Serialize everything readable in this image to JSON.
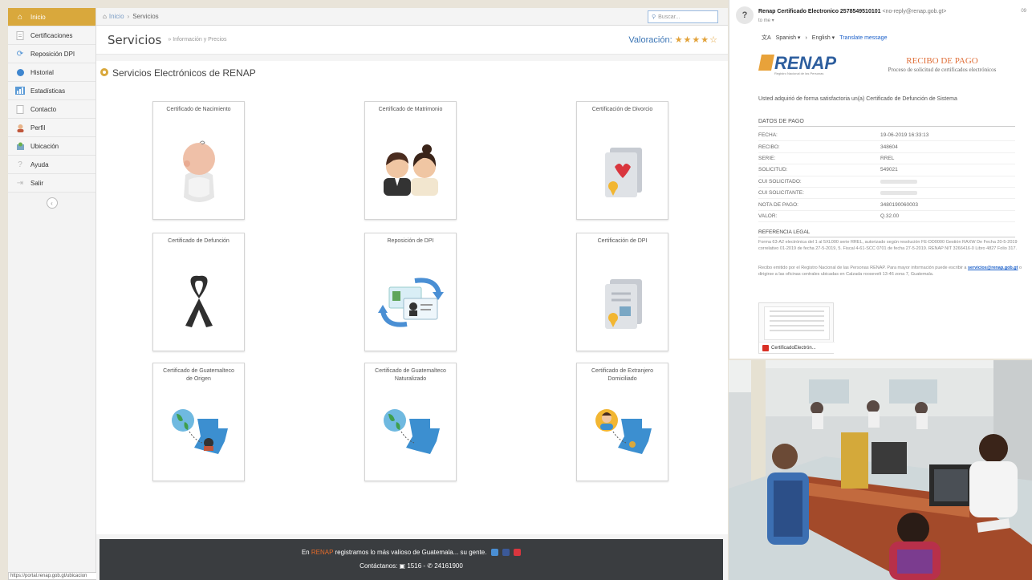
{
  "sidebar": {
    "items": [
      {
        "label": "Inicio",
        "icon": "home-icon"
      },
      {
        "label": "Certificaciones",
        "icon": "document-icon"
      },
      {
        "label": "Reposición DPI",
        "icon": "refresh-icon"
      },
      {
        "label": "Historial",
        "icon": "history-icon"
      },
      {
        "label": "Estadísticas",
        "icon": "chart-icon"
      },
      {
        "label": "Contacto",
        "icon": "contact-icon"
      },
      {
        "label": "Perfil",
        "icon": "user-icon"
      },
      {
        "label": "Ubicación",
        "icon": "location-icon"
      },
      {
        "label": "Ayuda",
        "icon": "help-icon"
      },
      {
        "label": "Salir",
        "icon": "logout-icon"
      }
    ],
    "active_color": "#d9a83c"
  },
  "statusbar": {
    "url": "https://portal.renap.gob.gt/ubicacion"
  },
  "breadcrumb": {
    "home": "Inicio",
    "current": "Servicios"
  },
  "search": {
    "placeholder": "Buscar..."
  },
  "header": {
    "title": "Servicios",
    "subtitle": "» Información y Precios",
    "rating_label": "Valoración:",
    "rating_stars": "★★★★☆",
    "rating_value": 4.5
  },
  "panel": {
    "title": "Servicios Electrónicos de RENAP"
  },
  "cards": [
    {
      "title": "Certificado de Nacimiento",
      "icon": "baby-icon"
    },
    {
      "title": "Certificado de Matrimonio",
      "icon": "couple-icon"
    },
    {
      "title": "Certificación de Divorcio",
      "icon": "broken-hearts-document-icon"
    },
    {
      "title": "Certificado de Defunción",
      "icon": "mourning-ribbon-icon"
    },
    {
      "title": "Reposición de DPI",
      "icon": "id-card-exchange-icon"
    },
    {
      "title": "Certificación de DPI",
      "icon": "certified-document-icon"
    },
    {
      "title": "Certificado de Guatemalteco de Origen",
      "icon": "globe-guatemala-map-icon"
    },
    {
      "title": "Certificado de Guatemalteco Naturalizado",
      "icon": "globe-guatemala-map-icon"
    },
    {
      "title": "Certificado de Extranjero Domiciliado",
      "icon": "person-guatemala-map-icon"
    }
  ],
  "footer": {
    "prefix": "En ",
    "brand": "RENAP",
    "text": " registramos lo más valioso de Guatemala... su gente.",
    "contact_label": "Contáctanos:",
    "phone_short": "1516",
    "phone_long": "24161900"
  },
  "email": {
    "subject": "Renap Certificado Electronico 2578549510101",
    "from": "<no-reply@renap.gob.gt>",
    "to": "to me ▾",
    "right_text": "09",
    "translate": {
      "from_lang": "Spanish ▾",
      "arrow": "›",
      "to_lang": "English ▾",
      "link": "Translate message"
    },
    "logo_text": "RENAP",
    "logo_sub": "Registro Nacional de las Personas",
    "recibo_title": "RECIBO DE PAGO",
    "recibo_subtitle": "Proceso de solicitud de certificados electrónicos",
    "intro": "Usted adquirió de forma satisfactoria un(a) Certificado de Defunción de Sistema",
    "datos_title": "DATOS DE PAGO",
    "rows": [
      {
        "k": "FECHA:",
        "v": "19-06-2019 16:33:13"
      },
      {
        "k": "RECIBO:",
        "v": "348604"
      },
      {
        "k": "SERIE:",
        "v": "RREL"
      },
      {
        "k": "SOLICITUD:",
        "v": "549021"
      },
      {
        "k": "CUI SOLICITADO:",
        "v": ""
      },
      {
        "k": "CUI SOLICITANTE:",
        "v": ""
      },
      {
        "k": "NOTA DE PAGO:",
        "v": "3480190060003"
      },
      {
        "k": "VALOR:",
        "v": "Q.32.00"
      }
    ],
    "ref_title": "REFERENCIA LEGAL",
    "ref_text1": "Forma 63-A2 electrónica del 1 al 5XL000 serie RREL, autorizado según resolución FE-DD0000 Gestión RAXW De Fecha 20-5-2019 correlativo 01-2019 de fecha 27-5-2019, 5. Fiscal 4-61-SCC 0701 de fecha 27-5-2019. RENAP NIT 3266416-0 Libro 4827 Folio 317.",
    "ref_text2a": "Recibo emitido por el Registro Nacional de las Personas RENAP. Para mayor información puede escribir a",
    "ref_email": "servicios@renap.gob.gt",
    "ref_text2b": "o dirigirse a las oficinas centrales ubicadas en Calzada roosevelt 13-46 zona 7, Guatemala.",
    "attachment_name": "CertificadoElectrón..."
  }
}
